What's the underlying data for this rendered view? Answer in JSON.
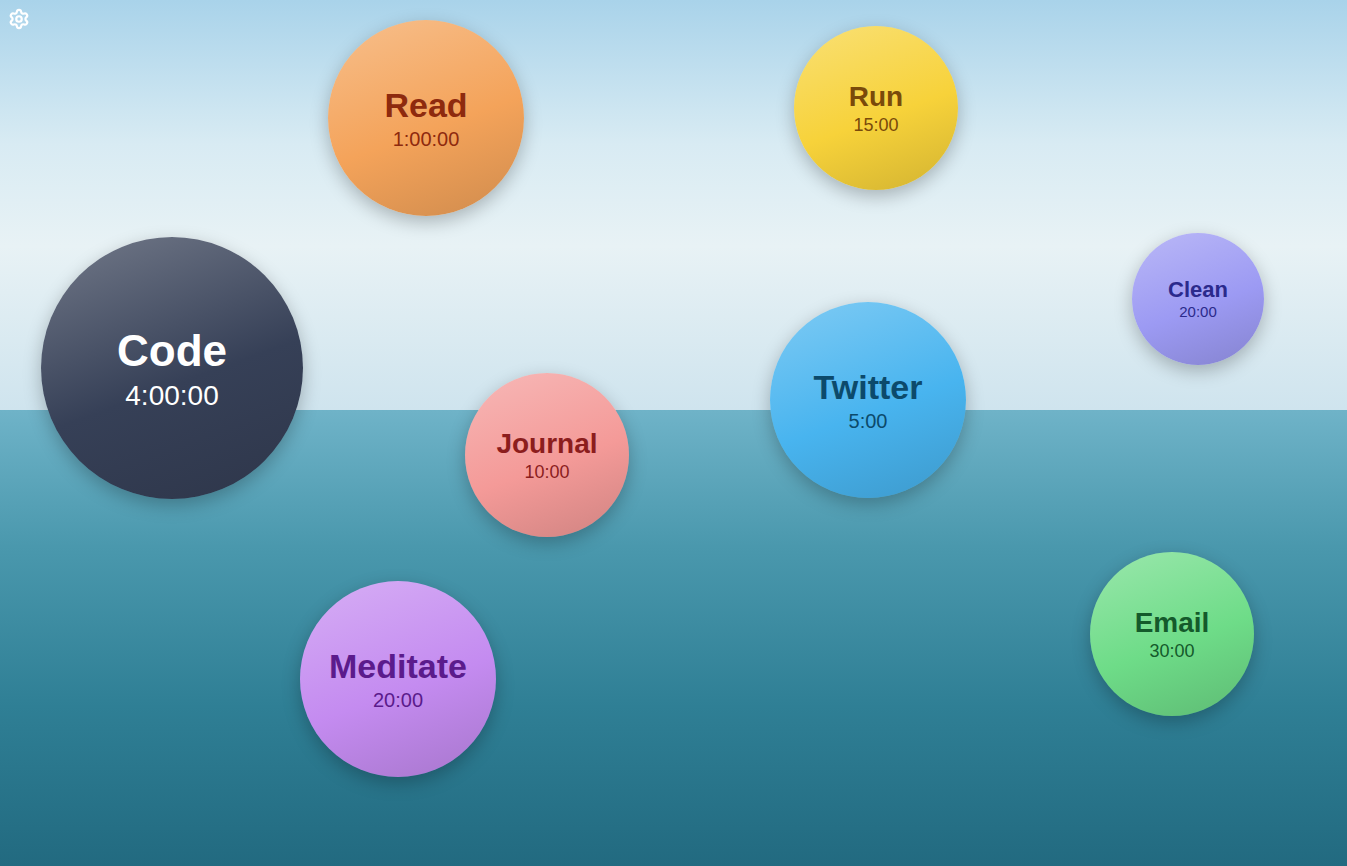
{
  "bubbles": [
    {
      "label": "Read",
      "time": "1:00:00",
      "color": "#f4a35a",
      "text_color": "#8e2a0e"
    },
    {
      "label": "Run",
      "time": "15:00",
      "color": "#f7d23a",
      "text_color": "#7a4a0a"
    },
    {
      "label": "Clean",
      "time": "20:00",
      "color": "#9c9af3",
      "text_color": "#2b2a8c"
    },
    {
      "label": "Code",
      "time": "4:00:00",
      "color": "#364057",
      "text_color": "#ffffff"
    },
    {
      "label": "Twitter",
      "time": "5:00",
      "color": "#48b4ef",
      "text_color": "#0c4a6b"
    },
    {
      "label": "Journal",
      "time": "10:00",
      "color": "#f49a98",
      "text_color": "#8c1d1d"
    },
    {
      "label": "Meditate",
      "time": "20:00",
      "color": "#c48bf0",
      "text_color": "#5b1b8c"
    },
    {
      "label": "Email",
      "time": "30:00",
      "color": "#6edc88",
      "text_color": "#145a2b"
    }
  ]
}
